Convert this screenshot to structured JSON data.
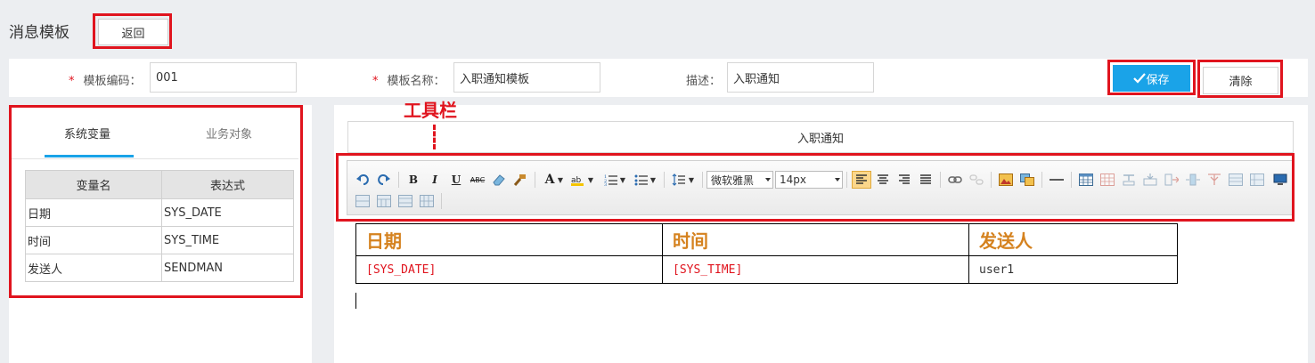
{
  "page": {
    "title": "消息模板",
    "back_label": "返回"
  },
  "form": {
    "code": {
      "label": "模板编码：",
      "required_mark": "*",
      "value": "001"
    },
    "name": {
      "label": "模板名称：",
      "required_mark": "*",
      "value": "入职通知模板"
    },
    "desc": {
      "label": "描述：",
      "value": "入职通知"
    },
    "save_label": "保存",
    "clear_label": "清除"
  },
  "left": {
    "tabs": [
      {
        "label": "系统变量",
        "active": true
      },
      {
        "label": "业务对象",
        "active": false
      }
    ],
    "columns": [
      "变量名",
      "表达式"
    ],
    "rows": [
      [
        "日期",
        "SYS_DATE"
      ],
      [
        "时间",
        "SYS_TIME"
      ],
      [
        "发送人",
        "SENDMAN"
      ]
    ]
  },
  "editor": {
    "subject": "入职通知",
    "toolbar": {
      "font_family": "微软雅黑",
      "font_size": "14px",
      "bold": "B",
      "italic": "I",
      "underline": "U",
      "strike": "ABC",
      "font_color": "A"
    },
    "table": {
      "header": [
        "日期",
        "时间",
        "发送人"
      ],
      "values": [
        "[SYS_DATE]",
        "[SYS_TIME]",
        "user1"
      ]
    }
  },
  "annotation": {
    "label": "工具栏"
  },
  "colors": {
    "accent": "#1aa3e8",
    "highlight": "#e0141e",
    "heading": "#d5821f"
  }
}
